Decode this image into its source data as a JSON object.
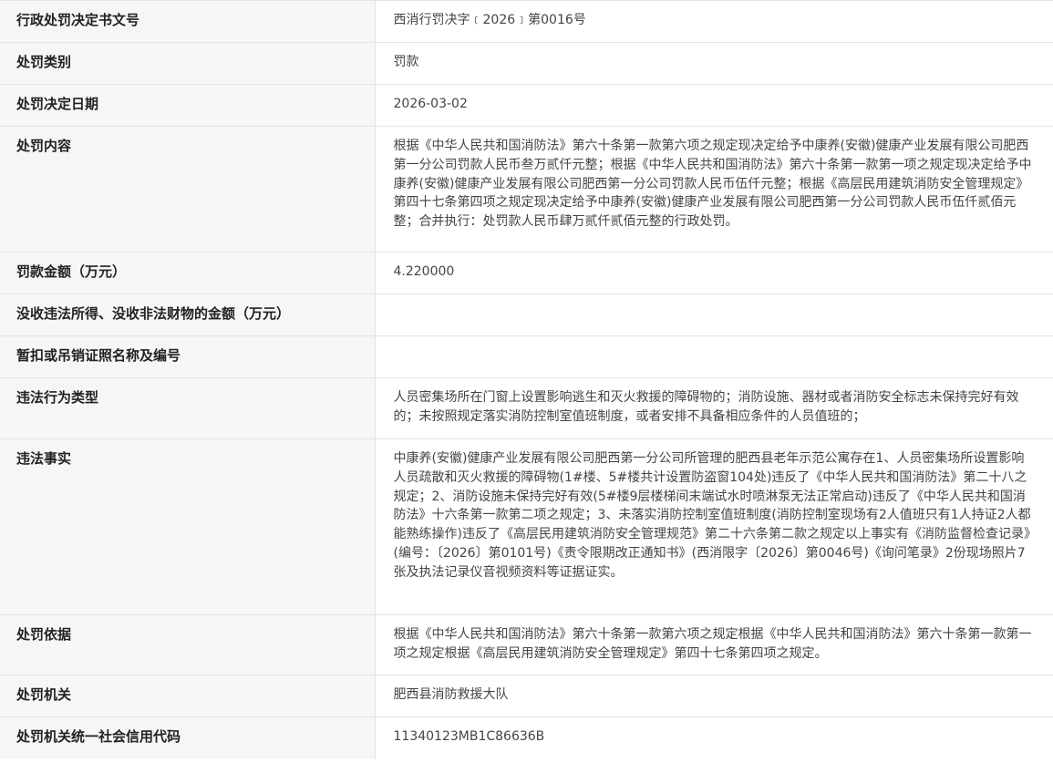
{
  "rows": [
    {
      "label": "行政处罚决定书文号",
      "value": "西消行罚决字﹝2026﹞第0016号"
    },
    {
      "label": "处罚类别",
      "value": "罚款"
    },
    {
      "label": "处罚决定日期",
      "value": "2026-03-02"
    },
    {
      "label": "处罚内容",
      "value": "根据《中华人民共和国消防法》第六十条第一款第六项之规定现决定给予中康养(安徽)健康产业发展有限公司肥西第一分公司罚款人民币叁万贰仟元整；根据《中华人民共和国消防法》第六十条第一款第一项之规定现决定给予中康养(安徽)健康产业发展有限公司肥西第一分公司罚款人民币伍仟元整；根据《高层民用建筑消防安全管理规定》第四十七条第四项之规定现决定给予中康养(安徽)健康产业发展有限公司肥西第一分公司罚款人民币伍仟贰佰元整；合并执行：处罚款人民币肆万贰仟贰佰元整的行政处罚。"
    },
    {
      "label": "罚款金额（万元）",
      "value": "4.220000"
    },
    {
      "label": "没收违法所得、没收非法财物的金额（万元）",
      "value": ""
    },
    {
      "label": "暂扣或吊销证照名称及编号",
      "value": ""
    },
    {
      "label": "违法行为类型",
      "value": "人员密集场所在门窗上设置影响逃生和灭火救援的障碍物的；消防设施、器材或者消防安全标志未保持完好有效的；未按照规定落实消防控制室值班制度，或者安排不具备相应条件的人员值班的；"
    },
    {
      "label": "违法事实",
      "value": "中康养(安徽)健康产业发展有限公司肥西第一分公司所管理的肥西县老年示范公寓存在1、人员密集场所设置影响人员疏散和灭火救援的障碍物(1#楼、5#楼共计设置防盗窗104处)违反了《中华人民共和国消防法》第二十八之规定；2、消防设施未保持完好有效(5#楼9层楼梯间末端试水时喷淋泵无法正常启动)违反了《中华人民共和国消防法》十六条第一款第二项之规定；3、未落实消防控制室值班制度(消防控制室现场有2人值班只有1人持证2人都能熟练操作)违反了《高层民用建筑消防安全管理规范》第二十六条第二款之规定以上事实有《消防监督检查记录》(编号：〔2026〕第0101号)《责令限期改正通知书》(西消限字〔2026〕第0046号)《询问笔录》2份现场照片7张及执法记录仪音视频资料等证据证实。"
    },
    {
      "label": "处罚依据",
      "value": "根据《中华人民共和国消防法》第六十条第一款第六项之规定根据《中华人民共和国消防法》第六十条第一款第一项之规定根据《高层民用建筑消防安全管理规定》第四十七条第四项之规定。"
    },
    {
      "label": "处罚机关",
      "value": "肥西县消防救援大队"
    },
    {
      "label": "处罚机关统一社会信用代码",
      "value": "11340123MB1C86636B"
    }
  ]
}
